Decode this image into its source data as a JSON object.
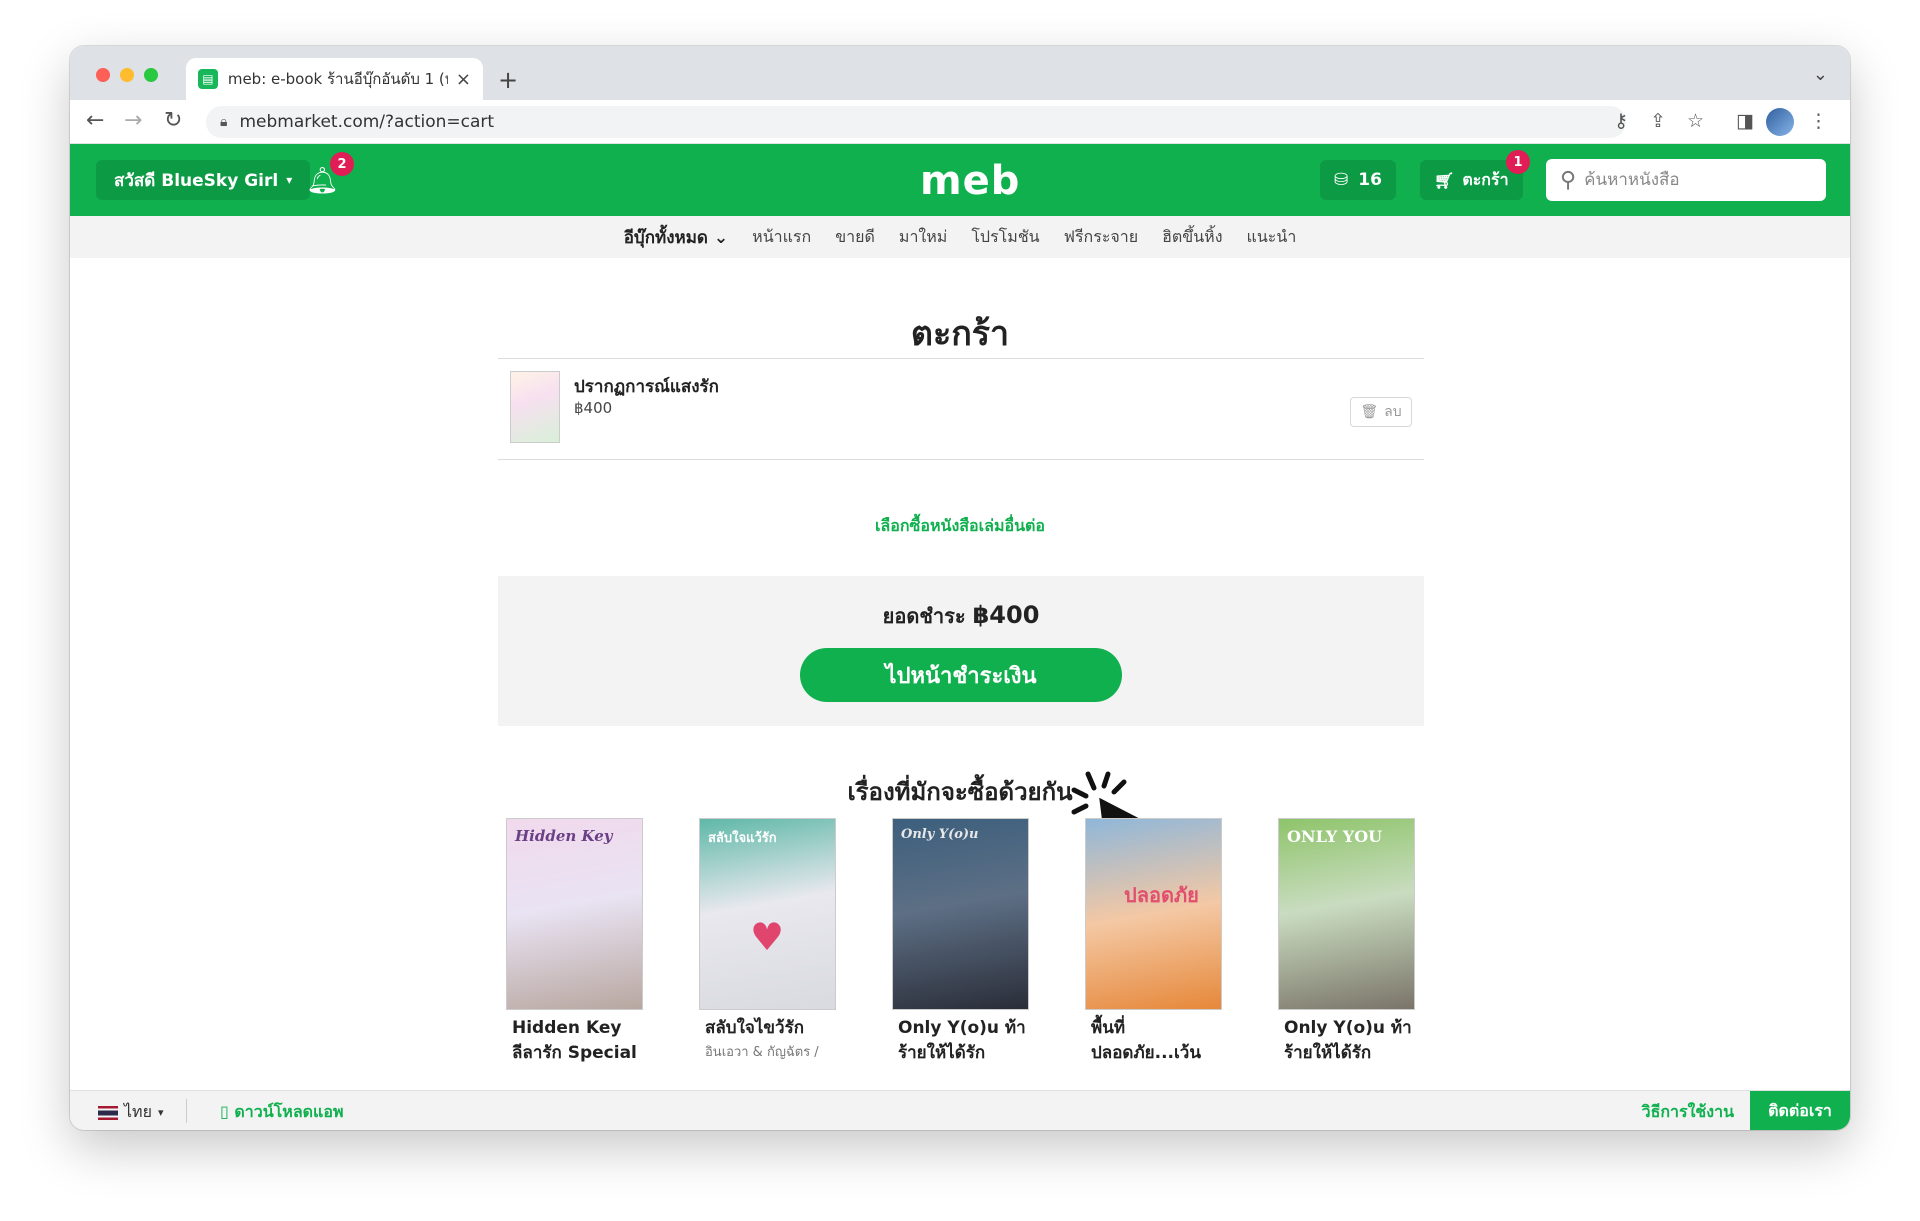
{
  "browser": {
    "tab_title": "meb: e-book ร้านอีบุ๊กอันดับ 1 (ห...",
    "new_tab": "+",
    "url": "mebmarket.com/?action=cart"
  },
  "header": {
    "greeting": "สวัสดี BlueSky Girl",
    "notification_count": "2",
    "logo": "meb",
    "coins": "16",
    "cart_label": "ตะกร้า",
    "cart_count": "1",
    "search_placeholder": "ค้นหาหนังสือ"
  },
  "nav": {
    "all": "อีบุ๊กทั้งหมด",
    "items": [
      "หน้าแรก",
      "ขายดี",
      "มาใหม่",
      "โปรโมชัน",
      "ฟรีกระจาย",
      "ฮิตขึ้นหิ้ง",
      "แนะนำ"
    ]
  },
  "cart": {
    "title": "ตะกร้า",
    "items": [
      {
        "title": "ปรากฏการณ์แสงรัก",
        "price": "฿400",
        "delete_label": "ลบ"
      }
    ],
    "continue_link": "เลือกซื้อหนังสือเล่มอื่นต่อ",
    "total_label": "ยอดชำระ",
    "total_amount": "฿400",
    "checkout_button": "ไปหน้าชำระเงิน"
  },
  "recommendations": {
    "title": "เรื่องที่มักจะซื้อด้วยกัน",
    "books": [
      {
        "title_line1": "Hidden Key",
        "title_line2": "ลีลารัก Special",
        "author": "",
        "cover_text": "Hidden Key"
      },
      {
        "title_line1": "สลับใจไขว้รัก",
        "title_line2": "",
        "author": "อินเอวา & กัญฉัตร /",
        "cover_text": "สลับใจแว้รัก"
      },
      {
        "title_line1": "Only Y(o)u ท้า",
        "title_line2": "ร้ายให้ได้รัก",
        "author": "",
        "cover_text": "Only Y(o)u"
      },
      {
        "title_line1": "พื้นที่",
        "title_line2": "ปลอดภัย...เว้น",
        "author": "",
        "cover_text": "ปลอดภัย"
      },
      {
        "title_line1": "Only Y(o)u ท้า",
        "title_line2": "ร้ายให้ได้รัก",
        "author": "",
        "cover_text": "ONLY YOU"
      }
    ]
  },
  "footer": {
    "language": "ไทย",
    "download_app": "ดาวน์โหลดแอพ",
    "how_to": "วิธีการใช้งาน",
    "contact": "ติดต่อเรา"
  },
  "colors": {
    "brand_green": "#10b04f",
    "badge_red": "#e01d55"
  }
}
